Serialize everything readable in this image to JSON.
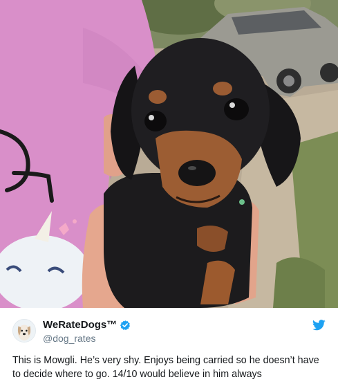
{
  "tweet": {
    "author_name": "WeRateDogs™",
    "author_handle": "@dog_rates",
    "text": "This is Mowgli. He’s very shy. Enjoys being carried so he doesn’t have to decide where to go. 14/10 would believe in him always",
    "verified": true
  },
  "icons": {
    "verified": "verified-badge-icon",
    "brand": "twitter-bird-icon"
  },
  "colors": {
    "twitter_blue": "#1da1f2",
    "name_text": "#14171a",
    "handle_text": "#657786",
    "shirt_pink": "#d98fc9"
  }
}
